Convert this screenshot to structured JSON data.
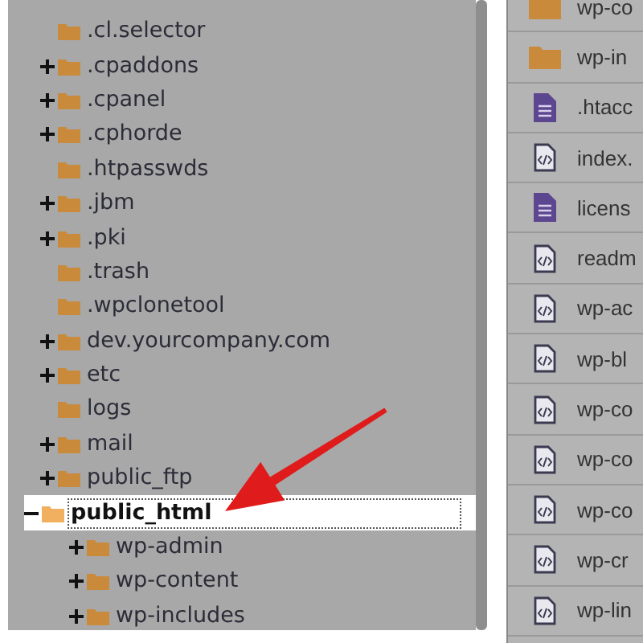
{
  "tree": [
    {
      "label": ".cl.selector",
      "kind": "leaf",
      "selected": false
    },
    {
      "label": ".cpaddons",
      "kind": "branch",
      "expanded": false,
      "selected": false
    },
    {
      "label": ".cpanel",
      "kind": "branch",
      "expanded": false,
      "selected": false
    },
    {
      "label": ".cphorde",
      "kind": "branch",
      "expanded": false,
      "selected": false
    },
    {
      "label": ".htpasswds",
      "kind": "leaf",
      "selected": false
    },
    {
      "label": ".jbm",
      "kind": "branch",
      "expanded": false,
      "selected": false
    },
    {
      "label": ".pki",
      "kind": "branch",
      "expanded": false,
      "selected": false
    },
    {
      "label": ".trash",
      "kind": "leaf",
      "selected": false
    },
    {
      "label": ".wpclonetool",
      "kind": "leaf",
      "selected": false
    },
    {
      "label": "dev.yourcompany.com",
      "kind": "branch",
      "expanded": false,
      "selected": false
    },
    {
      "label": "etc",
      "kind": "branch",
      "expanded": false,
      "selected": false
    },
    {
      "label": "logs",
      "kind": "leaf",
      "selected": false
    },
    {
      "label": "mail",
      "kind": "branch",
      "expanded": false,
      "selected": false
    },
    {
      "label": "public_ftp",
      "kind": "branch",
      "expanded": false,
      "selected": false
    },
    {
      "label": "public_html",
      "kind": "branch",
      "expanded": true,
      "selected": true,
      "children": [
        {
          "label": "wp-admin",
          "kind": "branch",
          "expanded": false,
          "selected": false
        },
        {
          "label": "wp-content",
          "kind": "branch",
          "expanded": false,
          "selected": false
        },
        {
          "label": "wp-includes",
          "kind": "branch",
          "expanded": false,
          "selected": false
        }
      ]
    }
  ],
  "files": [
    {
      "name": "wp-co",
      "kind": "folder"
    },
    {
      "name": "wp-in",
      "kind": "folder"
    },
    {
      "name": ".htacc",
      "kind": "text"
    },
    {
      "name": "index.",
      "kind": "code"
    },
    {
      "name": "licens",
      "kind": "text"
    },
    {
      "name": "readm",
      "kind": "code"
    },
    {
      "name": "wp-ac",
      "kind": "code"
    },
    {
      "name": "wp-bl",
      "kind": "code"
    },
    {
      "name": "wp-co",
      "kind": "code"
    },
    {
      "name": "wp-co",
      "kind": "code"
    },
    {
      "name": "wp-co",
      "kind": "code"
    },
    {
      "name": "wp-cr",
      "kind": "code"
    },
    {
      "name": "wp-lin",
      "kind": "code"
    }
  ]
}
